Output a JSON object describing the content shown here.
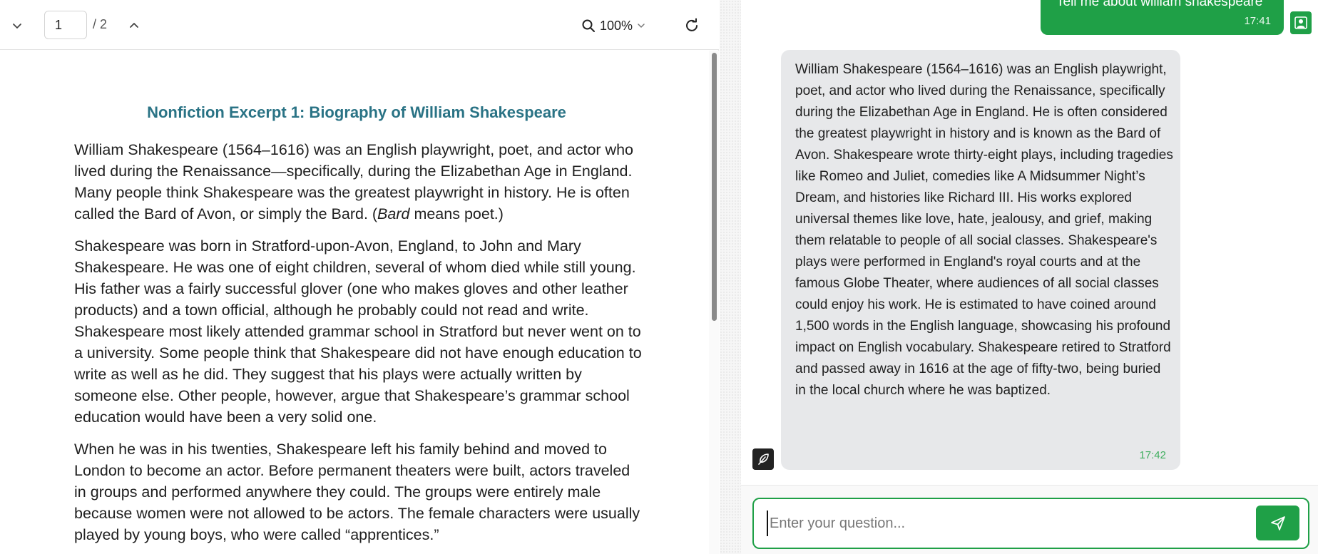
{
  "viewer": {
    "page_current": "1",
    "page_total": "/ 2",
    "zoom": "100%",
    "document": {
      "title": "Nonfiction Excerpt 1: Biography of William Shakespeare",
      "p1_a": "William Shakespeare (1564–1616) was an English playwright, poet, and actor who lived during the Renaissance—specifically, during the Elizabethan Age in England. Many people think Shakespeare was the greatest playwright in history. He is often called the Bard of Avon, or simply the Bard. (",
      "p1_italic": "Bard",
      "p1_b": " means poet.)",
      "p2": "Shakespeare was born in Stratford-upon-Avon, England, to John and Mary Shakespeare. He was one of eight children, several of whom died while still young. His father was a fairly successful glover (one who makes gloves and other leather products) and a town official, although he probably could not read and write. Shakespeare most likely attended grammar school in Stratford but never went on to a university. Some people think that Shakespeare did not have enough education to write as well as he did. They suggest that his plays were actually written by someone else. Other people, however, argue that Shakespeare’s grammar school education would have been a very solid one.",
      "p3": "When he was in his twenties, Shakespeare left his family behind and moved to London to become an actor. Before permanent theaters were built, actors traveled in groups and performed anywhere they could. The groups were entirely male because women were not allowed to be actors. The female characters were usually played by young boys, who were called “apprentices.”"
    }
  },
  "chat": {
    "user_message": {
      "text": "Tell me about william shakespeare",
      "time": "17:41"
    },
    "bot_message": {
      "text": "William Shakespeare (1564–1616) was an English playwright, poet, and actor who lived during the Renaissance, specifically during the Elizabethan Age in England. He is often considered the greatest playwright in history and is known as the Bard of Avon. Shakespeare wrote thirty-eight plays, including tragedies like Romeo and Juliet, comedies like A Midsummer Night’s Dream, and histories like Richard III. His works explored universal themes like love, hate, jealousy, and grief, making them relatable to people of all social classes. Shakespeare's plays were performed in England's royal courts and at the famous Globe Theater, where audiences of all social classes could enjoy his work. He is estimated to have coined around 1,500 words in the English language, showcasing his profound impact on English vocabulary. Shakespeare retired to Stratford and passed away in 1616 at the age of fifty-two, being buried in the local church where he was baptized.",
      "time": "17:42"
    },
    "input": {
      "placeholder": "Enter your question...",
      "value": ""
    }
  },
  "icons": {
    "prev_page": "chevron-down-icon",
    "next_page": "chevron-up-icon",
    "zoom": "search-icon",
    "zoom_dropdown": "chevron-down-icon",
    "refresh": "refresh-icon",
    "user_avatar": "user-icon",
    "bot_avatar": "feather-icon",
    "send": "send-icon"
  },
  "colors": {
    "accent": "#1fa047",
    "title": "#2a7385",
    "bot_bubble": "#e7e8ea"
  }
}
